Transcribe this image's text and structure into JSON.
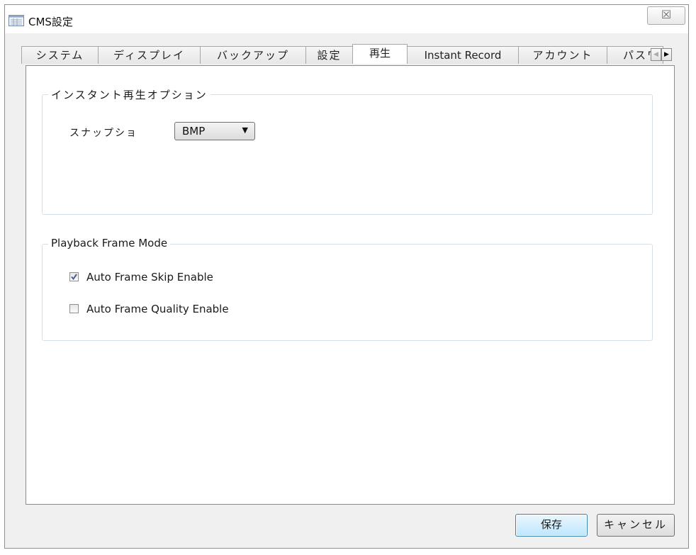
{
  "window": {
    "title": "CMS設定",
    "close_glyph": "☒"
  },
  "tabs": [
    {
      "label": "システム",
      "active": false
    },
    {
      "label": "ディスプレイ",
      "active": false
    },
    {
      "label": "バックアップ",
      "active": false
    },
    {
      "label": "設定",
      "active": false
    },
    {
      "label": "再生",
      "active": true
    },
    {
      "label": "Instant Record",
      "active": false
    },
    {
      "label": "アカウント",
      "active": false
    },
    {
      "label": "パスワ",
      "active": false
    }
  ],
  "tab_scroll": {
    "left_glyph": "◀",
    "right_glyph": "▶"
  },
  "instant_playback": {
    "title": "インスタント再生オプション",
    "snapshot_label": "スナップショ",
    "snapshot_format": "BMP"
  },
  "frame_mode": {
    "title": "Playback Frame Mode",
    "options": [
      {
        "label": "Auto Frame Skip Enable",
        "checked": true
      },
      {
        "label": "Auto Frame Quality Enable",
        "checked": false
      }
    ]
  },
  "footer": {
    "save_label": "保存",
    "cancel_label": "キャンセル"
  },
  "colors": {
    "accent": "#3c7fb1",
    "check": "#4a5f97"
  }
}
